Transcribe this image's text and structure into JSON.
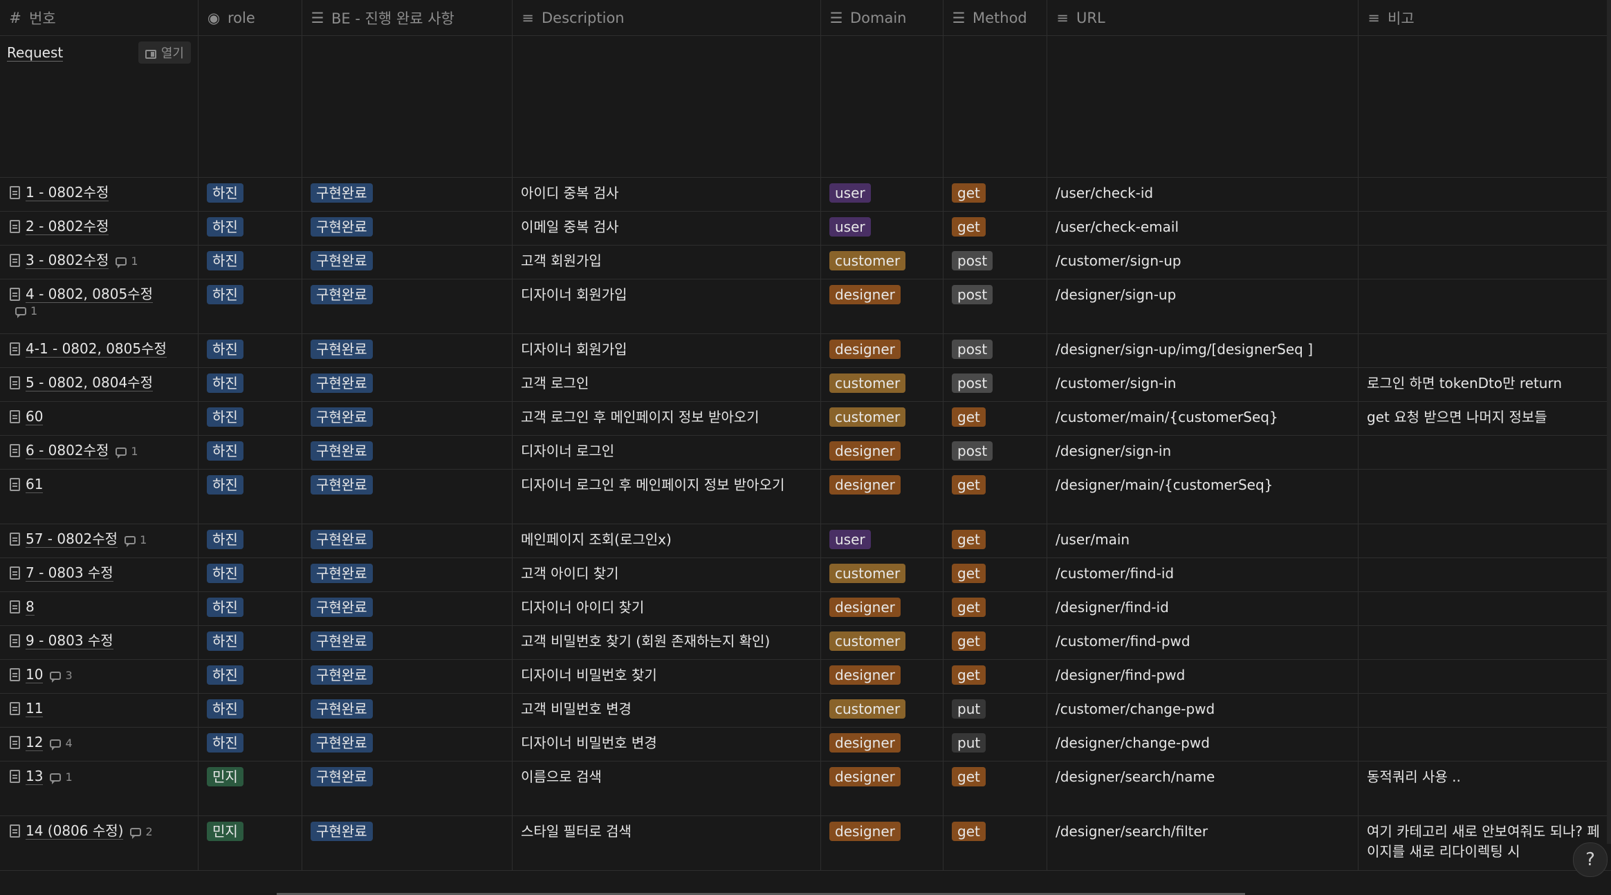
{
  "headers": [
    {
      "label": "번호",
      "icon": "hash-icon"
    },
    {
      "label": "role",
      "icon": "select-icon"
    },
    {
      "label": "BE - 진행 완료 사항",
      "icon": "list-icon"
    },
    {
      "label": "Description",
      "icon": "text-icon"
    },
    {
      "label": "Domain",
      "icon": "list-icon"
    },
    {
      "label": "Method",
      "icon": "list-icon"
    },
    {
      "label": "URL",
      "icon": "text-icon"
    },
    {
      "label": "비고",
      "icon": "text-icon"
    }
  ],
  "request": {
    "label": "Request",
    "open_label": "열기"
  },
  "rows": [
    {
      "name": "1 - 0802수정",
      "comments": "",
      "role": "하진",
      "status": "구현완료",
      "desc": "아이디 중복 검사",
      "domain": "user",
      "method": "get",
      "url": "/user/check-id",
      "note": ""
    },
    {
      "name": "2 - 0802수정",
      "comments": "",
      "role": "하진",
      "status": "구현완료",
      "desc": "이메일 중복 검사",
      "domain": "user",
      "method": "get",
      "url": "/user/check-email",
      "note": ""
    },
    {
      "name": "3 - 0802수정",
      "comments": "1",
      "role": "하진",
      "status": "구현완료",
      "desc": "고객 회원가입",
      "domain": "customer",
      "method": "post",
      "url": "/customer/sign-up",
      "note": ""
    },
    {
      "name": "4 - 0802, 0805수정",
      "comments": "1",
      "role": "하진",
      "status": "구현완료",
      "desc": "디자이너 회원가입",
      "domain": "designer",
      "method": "post",
      "url": "/designer/sign-up",
      "note": ""
    },
    {
      "name": "4-1 - 0802, 0805수정",
      "comments": "",
      "role": "하진",
      "status": "구현완료",
      "desc": "디자이너 회원가입",
      "domain": "designer",
      "method": "post",
      "url": "/designer/sign-up/img/[designerSeq ]",
      "note": ""
    },
    {
      "name": "5 - 0802, 0804수정",
      "comments": "",
      "role": "하진",
      "status": "구현완료",
      "desc": "고객 로그인",
      "domain": "customer",
      "method": "post",
      "url": "/customer/sign-in",
      "note": "로그인 하면 tokenDto만 return"
    },
    {
      "name": "60",
      "comments": "",
      "role": "하진",
      "status": "구현완료",
      "desc": "고객 로그인 후 메인페이지 정보 받아오기",
      "domain": "customer",
      "method": "get",
      "url": "/customer/main/{customerSeq}",
      "note": "get 요청 받으면 나머지 정보들"
    },
    {
      "name": "6 - 0802수정",
      "comments": "1",
      "role": "하진",
      "status": "구현완료",
      "desc": "디자이너 로그인",
      "domain": "designer",
      "method": "post",
      "url": "/designer/sign-in",
      "note": ""
    },
    {
      "name": "61",
      "comments": "",
      "role": "하진",
      "status": "구현완료",
      "desc": "디자이너 로그인 후 메인페이지 정보 받아오기",
      "domain": "designer",
      "method": "get",
      "url": "/designer/main/{customerSeq}",
      "note": ""
    },
    {
      "name": "57 - 0802수정",
      "comments": "1",
      "role": "하진",
      "status": "구현완료",
      "desc": "메인페이지 조회(로그인x)",
      "domain": "user",
      "method": "get",
      "url": "/user/main",
      "note": ""
    },
    {
      "name": "7 - 0803 수정",
      "comments": "",
      "role": "하진",
      "status": "구현완료",
      "desc": "고객 아이디 찾기",
      "domain": "customer",
      "method": "get",
      "url": "/customer/find-id",
      "note": ""
    },
    {
      "name": "8",
      "comments": "",
      "role": "하진",
      "status": "구현완료",
      "desc": "디자이너 아이디 찾기",
      "domain": "designer",
      "method": "get",
      "url": "/designer/find-id",
      "note": ""
    },
    {
      "name": "9 - 0803 수정",
      "comments": "",
      "role": "하진",
      "status": "구현완료",
      "desc": "고객 비밀번호 찾기 (회원 존재하는지 확인)",
      "domain": "customer",
      "method": "get",
      "url": "/customer/find-pwd",
      "note": ""
    },
    {
      "name": "10",
      "comments": "3",
      "role": "하진",
      "status": "구현완료",
      "desc": "디자이너 비밀번호 찾기",
      "domain": "designer",
      "method": "get",
      "url": "/designer/find-pwd",
      "note": ""
    },
    {
      "name": "11",
      "comments": "",
      "role": "하진",
      "status": "구현완료",
      "desc": "고객 비밀번호 변경",
      "domain": "customer",
      "method": "put",
      "url": "/customer/change-pwd",
      "note": ""
    },
    {
      "name": "12",
      "comments": "4",
      "role": "하진",
      "status": "구현완료",
      "desc": "디자이너 비밀번호 변경",
      "domain": "designer",
      "method": "put",
      "url": "/designer/change-pwd",
      "note": ""
    },
    {
      "name": "13",
      "comments": "1",
      "role": "민지",
      "status": "구현완료",
      "desc": "이름으로 검색",
      "domain": "designer",
      "method": "get",
      "url": "/designer/search/name",
      "note": "동적쿼리 사용 .."
    },
    {
      "name": "14 (0806 수정)",
      "comments": "2",
      "role": "민지",
      "status": "구현완료",
      "desc": "스타일 필터로 검색",
      "domain": "designer",
      "method": "get",
      "url": "/designer/search/filter",
      "note": "여기 카테고리 새로 안보여줘도 되나? 페이지를 새로 리다이렉팅 시"
    }
  ],
  "help_label": "?"
}
